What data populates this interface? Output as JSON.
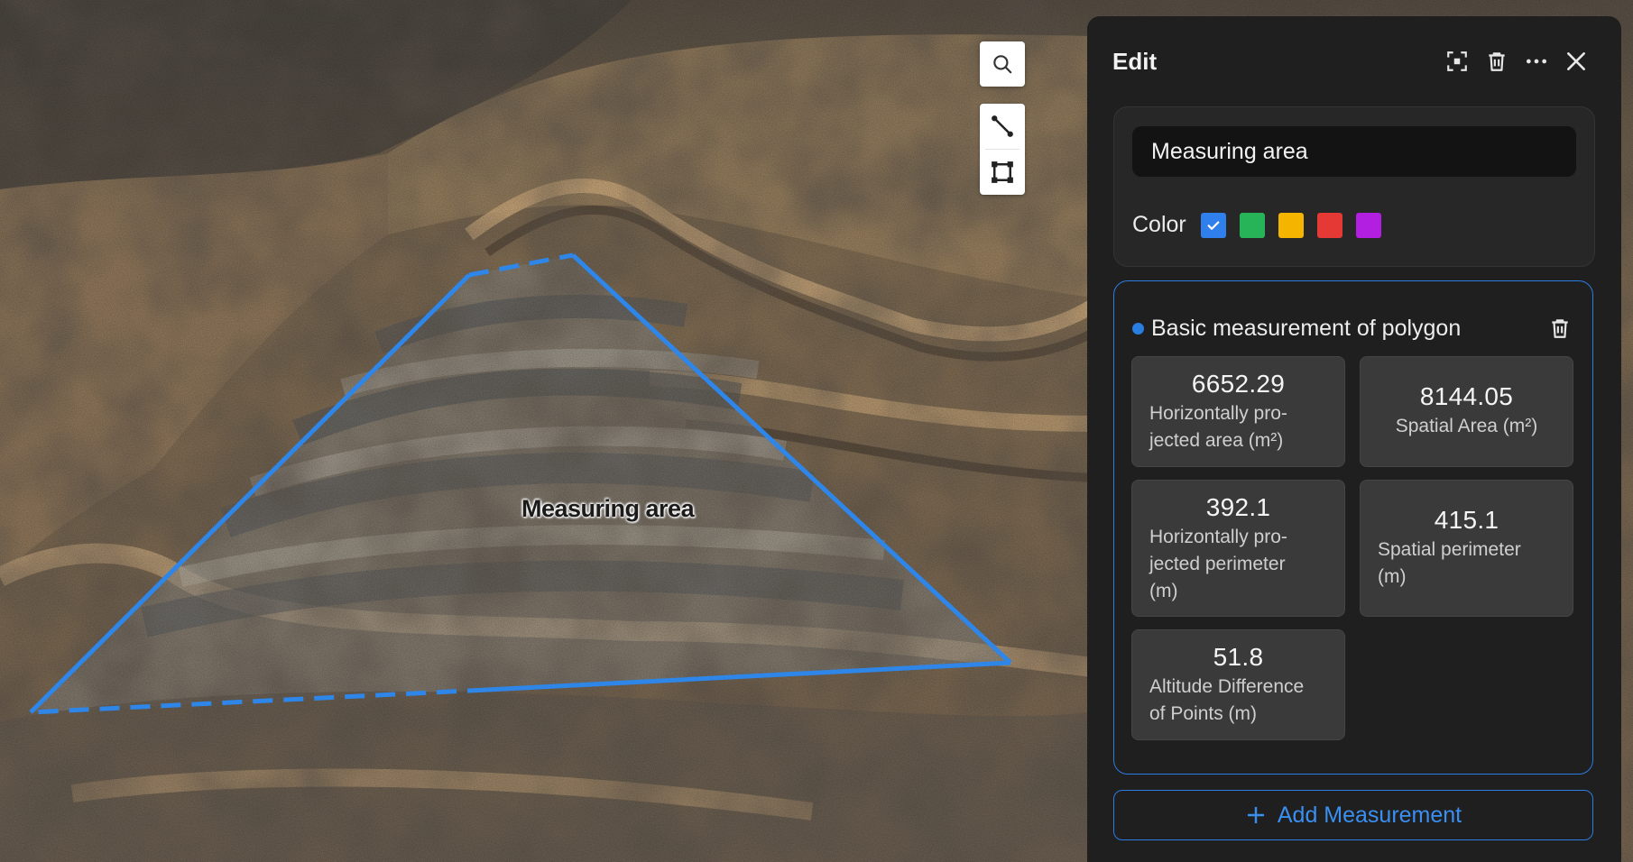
{
  "map": {
    "polygon_label": "Measuring area",
    "accent_color": "#2e86e8"
  },
  "map_tools": {
    "icons": [
      "search-icon",
      "line-measure-icon",
      "area-measure-icon"
    ]
  },
  "panel": {
    "title": "Edit",
    "header_icons": [
      "focus-icon",
      "trash-icon",
      "more-icon",
      "close-icon"
    ],
    "name_value": "Measuring area",
    "color_label": "Color",
    "colors": [
      {
        "name": "blue",
        "hex": "#2f80ed",
        "selected": true
      },
      {
        "name": "green",
        "hex": "#27b358",
        "selected": false
      },
      {
        "name": "yellow",
        "hex": "#f5b400",
        "selected": false
      },
      {
        "name": "red",
        "hex": "#e53935",
        "selected": false
      },
      {
        "name": "purple",
        "hex": "#b31fe0",
        "selected": false
      }
    ],
    "measurement": {
      "title": "Basic measurement of polygon",
      "metrics": [
        {
          "value": "6652.29",
          "label_lines": [
            "Horizontally pro-",
            "jected area (m²)"
          ]
        },
        {
          "value": "8144.05",
          "label_lines": [
            "Spatial Area (m²)"
          ]
        },
        {
          "value": "392.1",
          "label_lines": [
            "Horizontally pro-",
            "jected perimeter",
            "(m)"
          ]
        },
        {
          "value": "415.1",
          "label_lines": [
            "Spatial perimeter",
            "(m)"
          ]
        },
        {
          "value": "51.8",
          "label_lines": [
            "Altitude Difference",
            "of Points (m)"
          ]
        }
      ]
    },
    "add_button_label": "Add Measurement"
  }
}
